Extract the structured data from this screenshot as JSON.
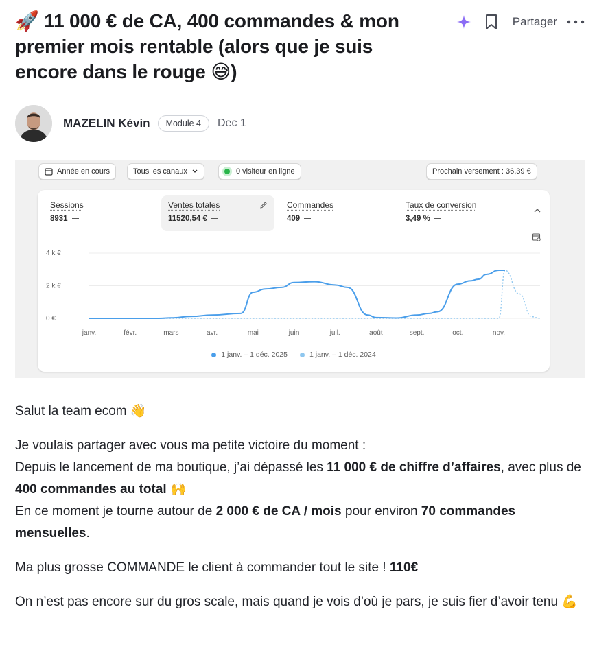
{
  "post": {
    "title_emoji": "🚀",
    "title": "11 000 € de CA, 400 commandes & mon premier mois rentable (alors que je suis encore dans le rouge 😅)"
  },
  "actions": {
    "share_label": "Partager"
  },
  "author": {
    "name": "MAZELIN Kévin",
    "badge": "Module 4",
    "date": "Dec 1"
  },
  "dashboard": {
    "filters": {
      "period": "Année en cours",
      "channels": "Tous les canaux",
      "visitors": "0 visiteur en ligne",
      "payout": "Prochain versement : 36,39 €"
    },
    "metrics": [
      {
        "label": "Sessions",
        "value": "8931"
      },
      {
        "label": "Ventes totales",
        "value": "11520,54 €"
      },
      {
        "label": "Commandes",
        "value": "409"
      },
      {
        "label": "Taux de conversion",
        "value": "3,49 %"
      }
    ],
    "legend": [
      {
        "label": "1 janv. – 1 déc. 2025",
        "color": "#4a9eea"
      },
      {
        "label": "1 janv. – 1 déc. 2024",
        "color": "#8fc7ef"
      }
    ]
  },
  "chart_data": {
    "type": "line",
    "categories": [
      "janv.",
      "févr.",
      "mars",
      "avr.",
      "mai",
      "juin",
      "juil.",
      "août",
      "sept.",
      "oct.",
      "nov."
    ],
    "y_ticks": [
      "4 k €",
      "2 k €",
      "0 €"
    ],
    "ylim": [
      0,
      4000
    ],
    "series": [
      {
        "name": "1 janv. – 1 déc. 2025",
        "x": [
          0,
          1,
          1.7,
          2,
          2.5,
          3,
          3.7,
          4,
          4.3,
          4.7,
          5,
          5.5,
          6,
          6.3,
          6.8,
          7,
          7.5,
          8,
          8.3,
          8.5,
          9,
          9.3,
          9.5,
          9.7,
          10,
          10.15
        ],
        "values": [
          0,
          0,
          0,
          30,
          120,
          200,
          300,
          1600,
          1800,
          1900,
          2200,
          2250,
          2050,
          1900,
          200,
          50,
          20,
          200,
          300,
          400,
          2100,
          2300,
          2400,
          2700,
          2950,
          2950
        ]
      },
      {
        "name": "1 janv. – 1 déc. 2024",
        "x": [
          0,
          1,
          2,
          3,
          4,
          5,
          6,
          7,
          8,
          9,
          10,
          10.15,
          10.5,
          10.8,
          11
        ],
        "values": [
          0,
          0,
          0,
          0,
          0,
          0,
          0,
          0,
          0,
          0,
          0,
          2950,
          1500,
          100,
          0
        ]
      }
    ]
  },
  "content": {
    "p1": "Salut la team ecom 👋",
    "p2_a": "Je voulais partager avec vous ma petite victoire du moment :",
    "p2_b": "Depuis le lancement de ma boutique, j’ai dépassé les ",
    "p2_b_bold": "11 000 € de chiffre d’affaires",
    "p2_c": ", avec plus de ",
    "p2_c_bold": "400 commandes au total",
    "p2_c_end": " 🙌",
    "p2_d": "En ce moment je tourne autour de ",
    "p2_d_bold": "2 000 € de CA / mois",
    "p2_e": " pour environ ",
    "p2_e_bold": "70 commandes mensuelles",
    "p2_e_end": ".",
    "p3": "Ma plus grosse COMMANDE le client à commander tout le site ! ",
    "p3_bold": "110€",
    "p4": "On n’est pas encore sur du gros scale, mais quand je vois d’où je pars, je suis fier d’avoir tenu 💪"
  }
}
